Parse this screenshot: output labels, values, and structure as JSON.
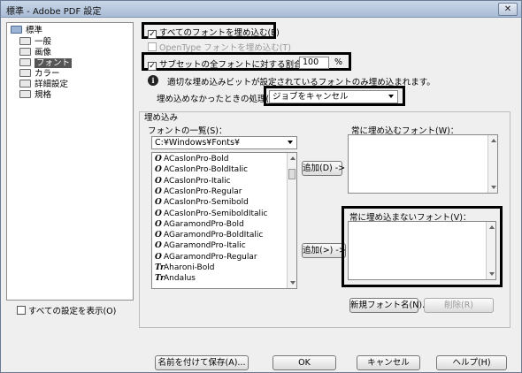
{
  "window": {
    "title": "標準 - Adobe PDF 設定",
    "close_glyph": "✕"
  },
  "tree": {
    "root": "標準",
    "items": [
      {
        "label": "一般"
      },
      {
        "label": "画像"
      },
      {
        "label": "フォント"
      },
      {
        "label": "カラー"
      },
      {
        "label": "詳細設定"
      },
      {
        "label": "規格"
      }
    ]
  },
  "show_all_settings": {
    "label": "すべての設定を表示(O)",
    "checked": false
  },
  "fonts": {
    "embed_all_label": "すべてのフォントを埋め込む(E)",
    "embed_opentype_label": "OpenType フォントを埋め込む(T)",
    "subset_label": "サブセットの全フォントに対する割合(B)：",
    "subset_value": "100",
    "subset_unit": "%",
    "info_text": "適切な埋め込みビットが設定されているフォントのみ埋め込まれます。",
    "fail_label": "埋め込めなかったときの処理(F)",
    "fail_value": "ジョブをキャンセル"
  },
  "embedding": {
    "group_label": "埋め込み",
    "list_label": "フォントの一覧(S)：",
    "folder_value": "C:¥Windows¥Fonts¥",
    "font_list": [
      {
        "name": "ACaslonPro-Bold",
        "icon": "O"
      },
      {
        "name": "ACaslonPro-BoldItalic",
        "icon": "O"
      },
      {
        "name": "ACaslonPro-Italic",
        "icon": "O"
      },
      {
        "name": "ACaslonPro-Regular",
        "icon": "O"
      },
      {
        "name": "ACaslonPro-Semibold",
        "icon": "O"
      },
      {
        "name": "ACaslonPro-SemiboldItalic",
        "icon": "O"
      },
      {
        "name": "AGaramondPro-Bold",
        "icon": "O"
      },
      {
        "name": "AGaramondPro-BoldItalic",
        "icon": "O"
      },
      {
        "name": "AGaramondPro-Italic",
        "icon": "O"
      },
      {
        "name": "AGaramondPro-Regular",
        "icon": "O"
      },
      {
        "name": "Aharoni-Bold",
        "icon": "Tr"
      },
      {
        "name": "Andalus",
        "icon": "Tr"
      }
    ],
    "always_embed_label": "常に埋め込むフォント(W)：",
    "never_embed_label": "常に埋め込まないフォント(V)：",
    "add_embed_button": "追加(D) ->",
    "add_never_button": "追加(>) ->",
    "new_font_button": "新規フォント名(N)...",
    "remove_button": "削除(R)"
  },
  "footer": {
    "save_as": "名前を付けて保存(A)...",
    "ok": "OK",
    "cancel": "キャンセル",
    "help": "ヘルプ(H)"
  }
}
